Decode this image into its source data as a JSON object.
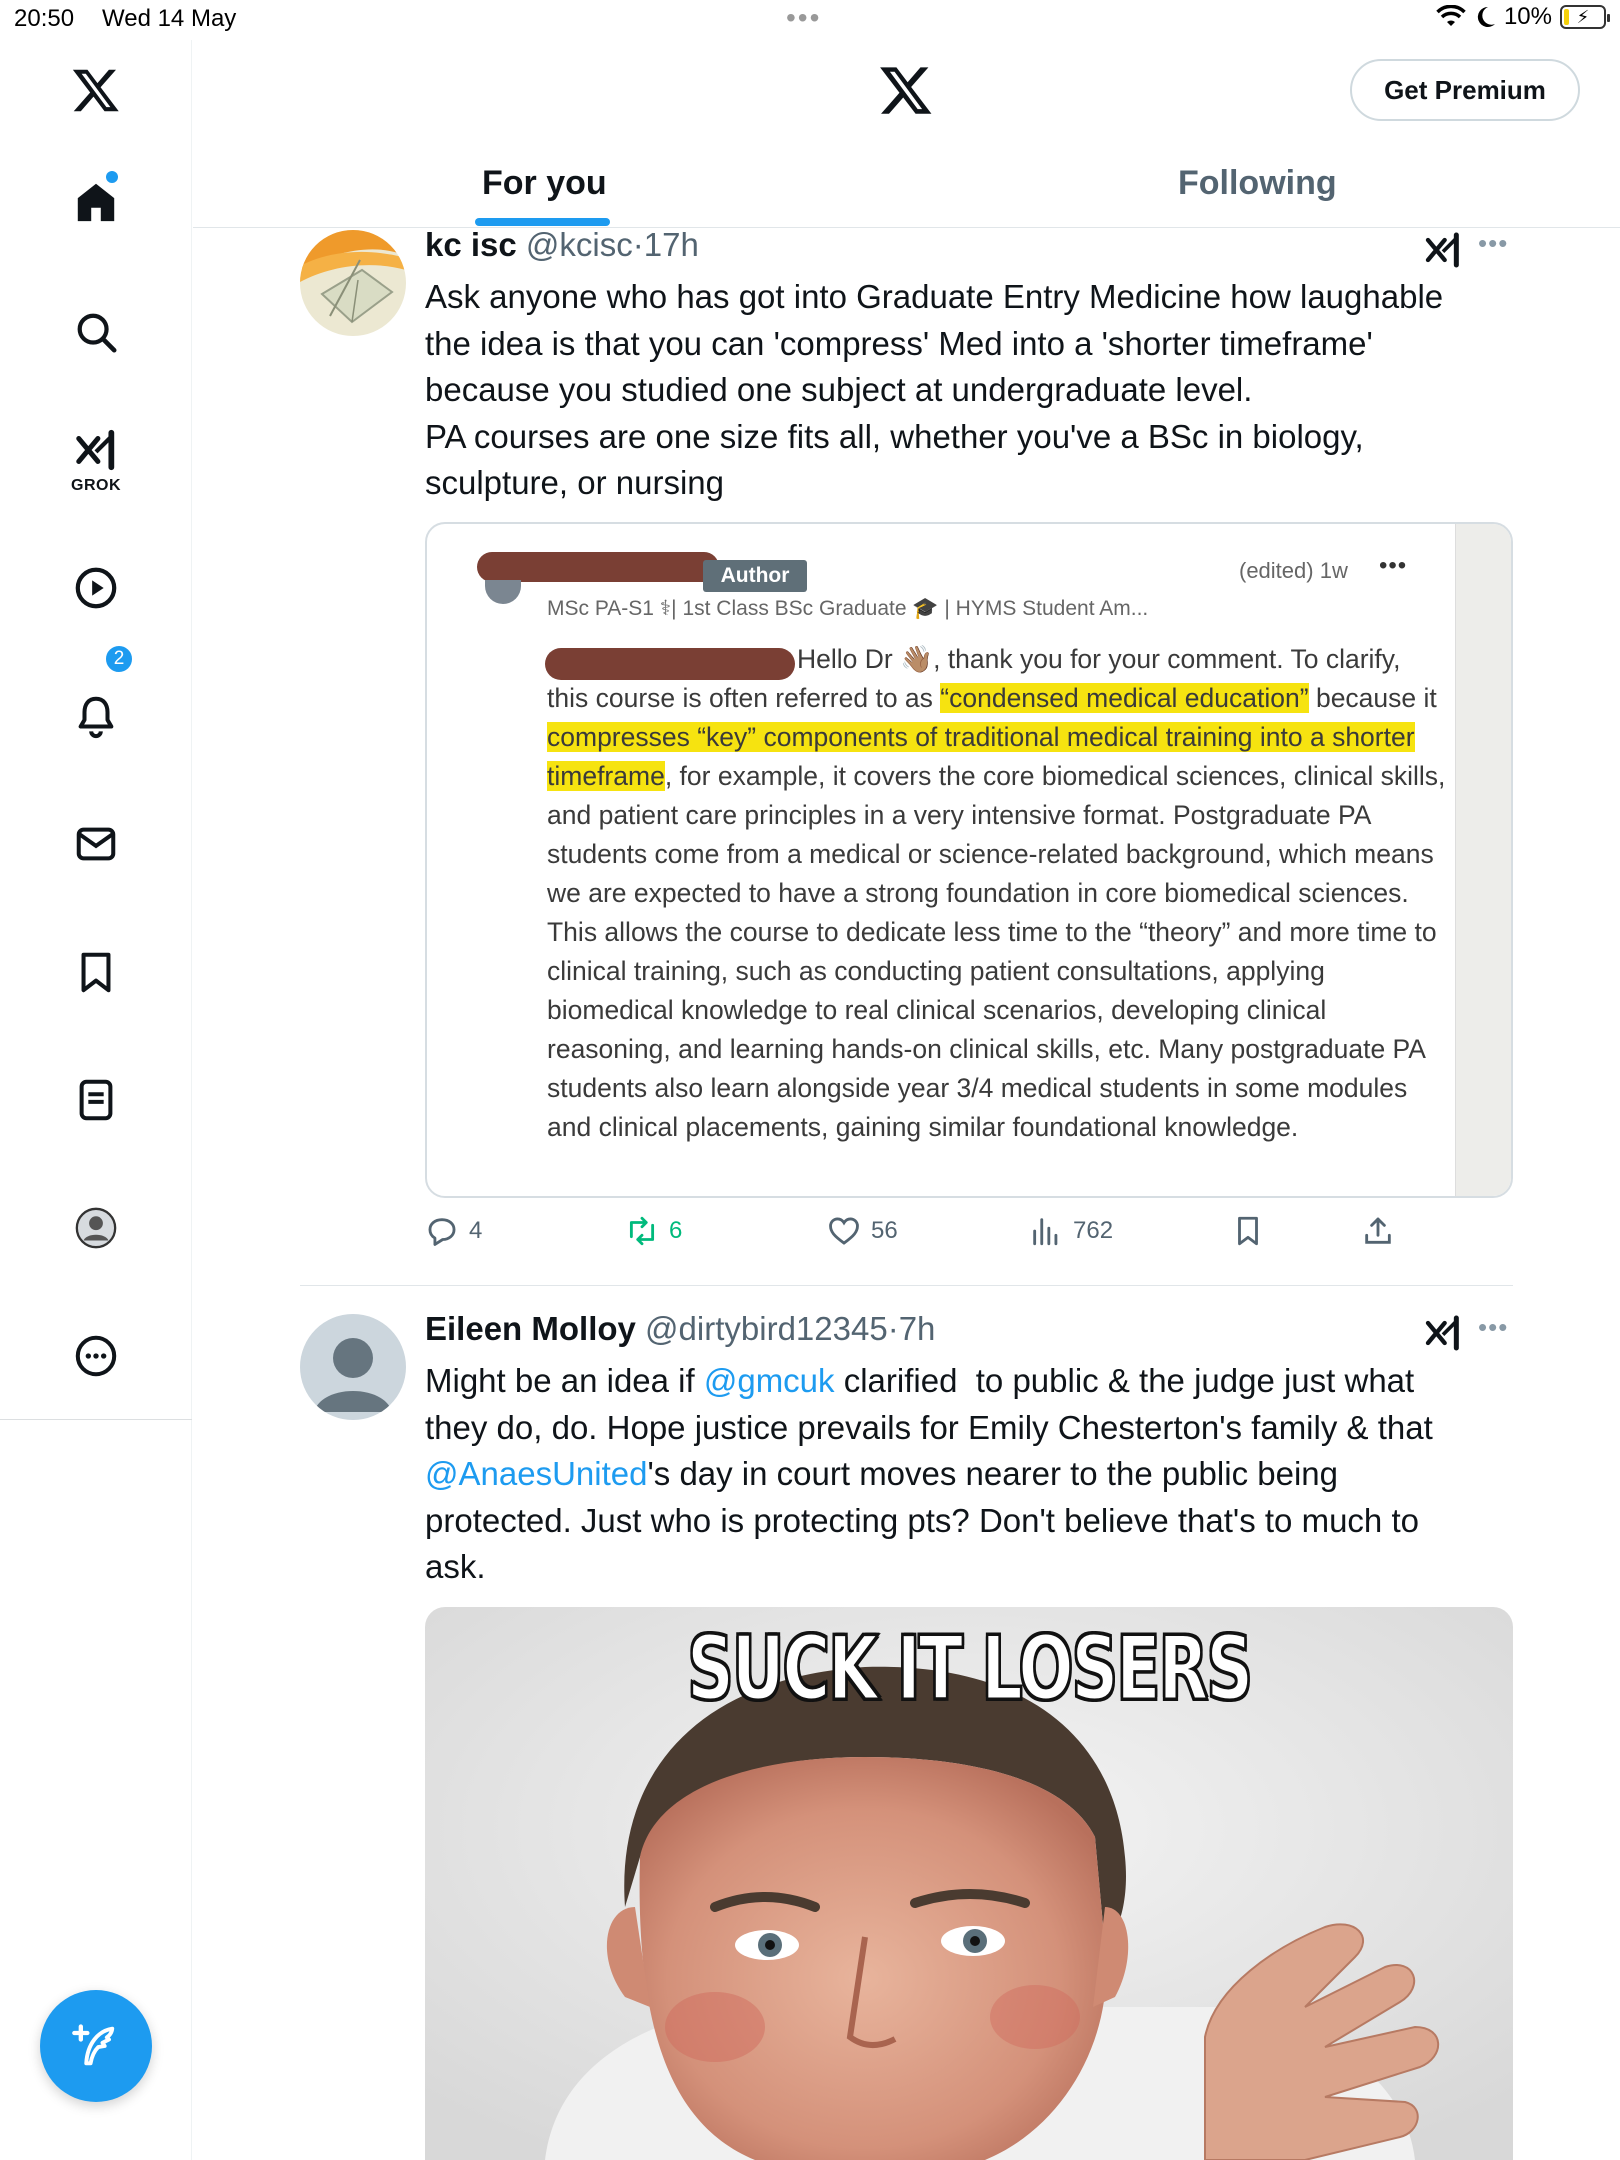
{
  "status_bar": {
    "time": "20:50",
    "date": "Wed 14 May",
    "battery_pct": "10%"
  },
  "sidebar": {
    "items": [
      {
        "name": "x-logo-icon"
      },
      {
        "name": "home-icon"
      },
      {
        "name": "search-icon"
      },
      {
        "name": "grok-icon",
        "label": "GROK"
      },
      {
        "name": "video-icon"
      },
      {
        "name": "notifications-icon",
        "badge": "2"
      },
      {
        "name": "messages-icon"
      },
      {
        "name": "bookmarks-icon"
      },
      {
        "name": "lists-icon"
      },
      {
        "name": "profile-icon"
      },
      {
        "name": "more-icon"
      }
    ],
    "accent_color": "#1d9bf0"
  },
  "header": {
    "premium_label": "Get Premium"
  },
  "tabs": [
    {
      "label": "For you",
      "active": true
    },
    {
      "label": "Following",
      "active": false
    }
  ],
  "tweets": [
    {
      "name": "kc isc",
      "handle": "@kcisc",
      "time": "17h",
      "text_lines": [
        "Ask anyone who has got into Graduate Entry Medicine how laughable",
        "the idea is that you can 'compress' Med into a 'shorter timeframe'",
        "because you studied one subject at undergraduate level.",
        "PA courses are one size fits all, whether you've a BSc in biology,",
        "sculpture, or nursing"
      ],
      "quoted_screenshot": {
        "tag": "Author",
        "subtitle": "MSc PA-S1 ⚕| 1st Class BSc Graduate 🎓 | HYMS Student Am...",
        "edited": "(edited) 1w",
        "more": "•••",
        "body": {
          "p1": "Hello Dr 👋🏽, thank you for your comment. To clarify,",
          "p2": "this course is often referred to as ",
          "h1": "“condensed medical education”",
          "p3": "because it ",
          "h2": "compresses “key” components of traditional medical training into a shorter timeframe",
          "p4": ", for example, it covers the core biomedical sciences, clinical skills, and patient care principles in a very intensive format. Postgraduate PA students come from a medical or science-related background, which means we are expected to have a strong foundation in core biomedical sciences. This allows the course to dedicate less time to the “theory” and more time to clinical training, such as conducting patient consultations, applying biomedical knowledge to real clinical scenarios, developing clinical reasoning, and learning hands-on clinical skills, etc. Many postgraduate PA students also learn alongside year 3/4 medical students in some modules and clinical placements, gaining similar foundational knowledge."
        }
      },
      "stats": {
        "replies": "4",
        "reposts": "6",
        "likes": "56",
        "views": "762"
      }
    },
    {
      "name": "Eileen Molloy",
      "handle": "@dirtybird12345",
      "time": "7h",
      "text": {
        "a": "Might be an idea if ",
        "m1": "@gmcuk",
        "b": " clarified  to public & the judge just what",
        "c": "they do, do. Hope justice prevails for Emily Chesterton's family & that",
        "m2": "@AnaesUnited",
        "d": "'s day in court moves nearer to the public being",
        "e": "protected. Just who is protecting pts? Don't believe that's to much to",
        "f": "ask."
      },
      "meme_caption": "SUCK IT LOSERS"
    }
  ],
  "separator": "·",
  "more": "•••",
  "colors": {
    "accent": "#1d9bf0",
    "repost": "#00ba7c",
    "highlight": "#f6e310",
    "secondary_text": "#536471"
  }
}
